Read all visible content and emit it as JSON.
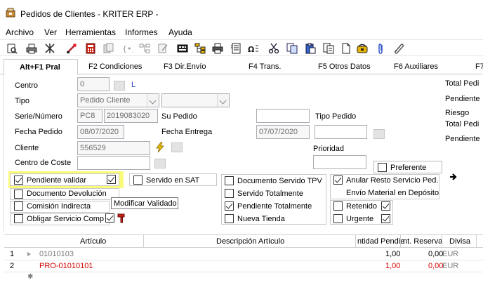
{
  "window": {
    "title": "Pedidos de Clientes - KRITER ERP -"
  },
  "menu": [
    "Archivo",
    "Ver",
    "Herramientas",
    "Informes",
    "Ayuda"
  ],
  "tabs": [
    {
      "label": "Alt+F1 Pral",
      "active": true
    },
    {
      "label": "F2 Condiciones"
    },
    {
      "label": "F3 Dir.Envío"
    },
    {
      "label": "F4 Trans."
    },
    {
      "label": "F5 Otros Datos"
    },
    {
      "label": "F6 Auxiliares"
    },
    {
      "label": "F7"
    }
  ],
  "form": {
    "centro_label": "Centro",
    "centro_value": "0",
    "centro_link": "L",
    "tipo_label": "Tipo",
    "tipo_value": "Pedido Cliente",
    "serie_label": "Serie/Número",
    "serie_value": "PC8",
    "numero_value": "2019083020",
    "su_pedido_label": "Su Pedido",
    "tipo_pedido_label": "Tipo Pedido",
    "fecha_pedido_label": "Fecha Pedido",
    "fecha_pedido_value": "08/07/2020",
    "fecha_entrega_label": "Fecha Entrega",
    "fecha_entrega_value": "07/07/2020",
    "cliente_label": "Cliente",
    "cliente_value": "556529",
    "prioridad_label": "Prioridad",
    "centro_coste_label": "Centro de Coste",
    "preferente_label": "Preferente"
  },
  "checkboxes": {
    "pendiente_validar": "Pendiente validar",
    "servido_sat": "Servido en SAT",
    "documento_servido_tpv": "Documento Servido TPV",
    "anular_resto": "Anular Resto Servicio Ped.",
    "documento_devolucion": "Documento Devolución",
    "servido_totalmente": "Servido Totalmente",
    "envio_material": "Envío Material en Depósito",
    "comision_indirecta": "Comisión Indirecta",
    "pendiente_totalmente": "Pendiente Totalmente",
    "retenido": "Retenido",
    "obligar_servicio": "Obligar Servicio Comp",
    "nueva_tienda": "Nueva Tienda",
    "urgente": "Urgente"
  },
  "tooltip": "Modificar Validado",
  "right_panel": [
    "Total Pedi",
    "Pendiente",
    "Riesgo",
    "Total Pedi",
    "Pendiente"
  ],
  "grid": {
    "headers": [
      "Artículo",
      "Descripción Artículo",
      "ntidad Pendie",
      "nt. Reserva",
      "Divisa"
    ],
    "rows": [
      {
        "num": "1",
        "articulo": "01010103",
        "cantidad": "1,00",
        "reserva": "0,00",
        "divisa": "EUR"
      },
      {
        "num": "2",
        "articulo": "PRO-01010101",
        "cantidad": "1,00",
        "reserva": "0,00",
        "divisa": "EUR"
      }
    ],
    "new_row_marker": "✱"
  },
  "colors": {
    "highlight": "#fbfb7a",
    "error_red": "#d40000",
    "link_blue": "#1f3fbf"
  }
}
